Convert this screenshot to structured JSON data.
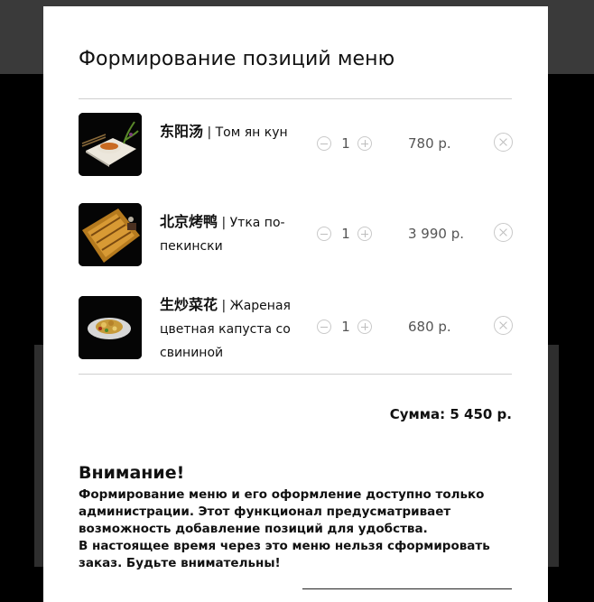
{
  "modal": {
    "title": "Формирование позиций меню",
    "items": [
      {
        "name_zh": "东阳汤",
        "name_ru": " | Том ян кун",
        "qty": "1",
        "price": "780 р."
      },
      {
        "name_zh": "北京烤鸭",
        "name_ru": " | Утка по-пекински",
        "qty": "1",
        "price": "3 990 р."
      },
      {
        "name_zh": "生炒菜花",
        "name_ru": " | Жареная цветная капуста со свининой",
        "qty": "1",
        "price": "680 р."
      }
    ],
    "total": "Сумма: 5 450 р.",
    "warning_title": "Внимание!",
    "warning_text": "Формирование меню и его оформление доступно только администрации. Этот функционал предусматривает возможность добавление позиций для удобства.\nВ настоящее время через это меню нельзя сформировать заказ. Будьте внимательны!"
  },
  "icons": {
    "minus": "minus-circle-icon",
    "plus": "plus-circle-icon",
    "remove": "close-circle-icon"
  },
  "colors": {
    "background": "#000000",
    "modal": "#ffffff",
    "muted": "#bdbdbd",
    "text": "#111111"
  }
}
